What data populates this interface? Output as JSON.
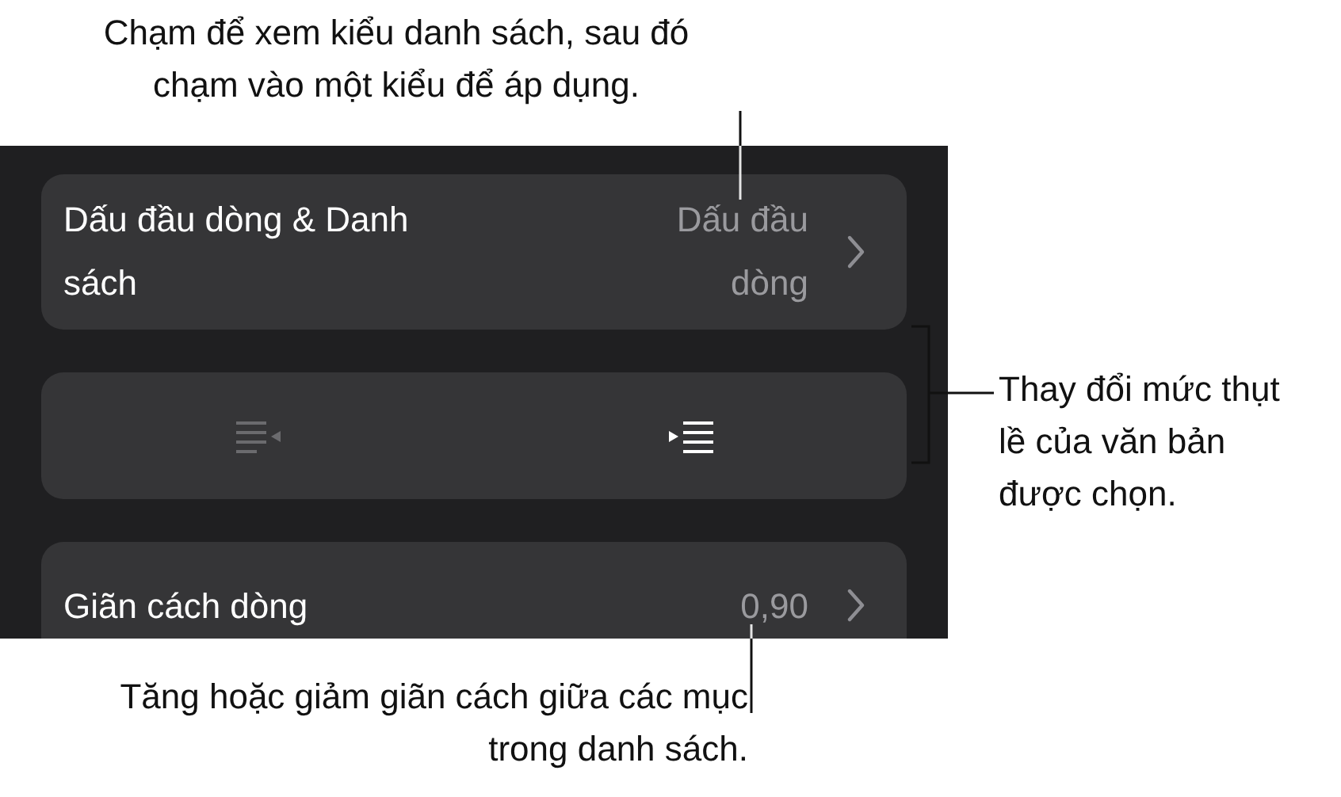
{
  "callouts": [
    {
      "kind": "top",
      "text": "Chạm để xem kiểu danh sách, sau đó chạm vào một kiểu để áp dụng."
    },
    {
      "kind": "right",
      "text": "Thay đổi mức thụt lề của văn bản được chọn."
    },
    {
      "kind": "bottom",
      "text": "Tăng hoặc giảm giãn cách giữa các mục trong danh sách."
    }
  ],
  "panel": {
    "bullets_row": {
      "label": "Dấu đầu dòng & Danh sách",
      "value": "Dấu đầu dòng"
    },
    "indent_buttons": [
      {
        "kind": "outdent",
        "disabled": true
      },
      {
        "kind": "indent",
        "disabled": false
      }
    ],
    "spacing_row": {
      "label": "Giãn cách dòng",
      "value": "0,90"
    }
  }
}
